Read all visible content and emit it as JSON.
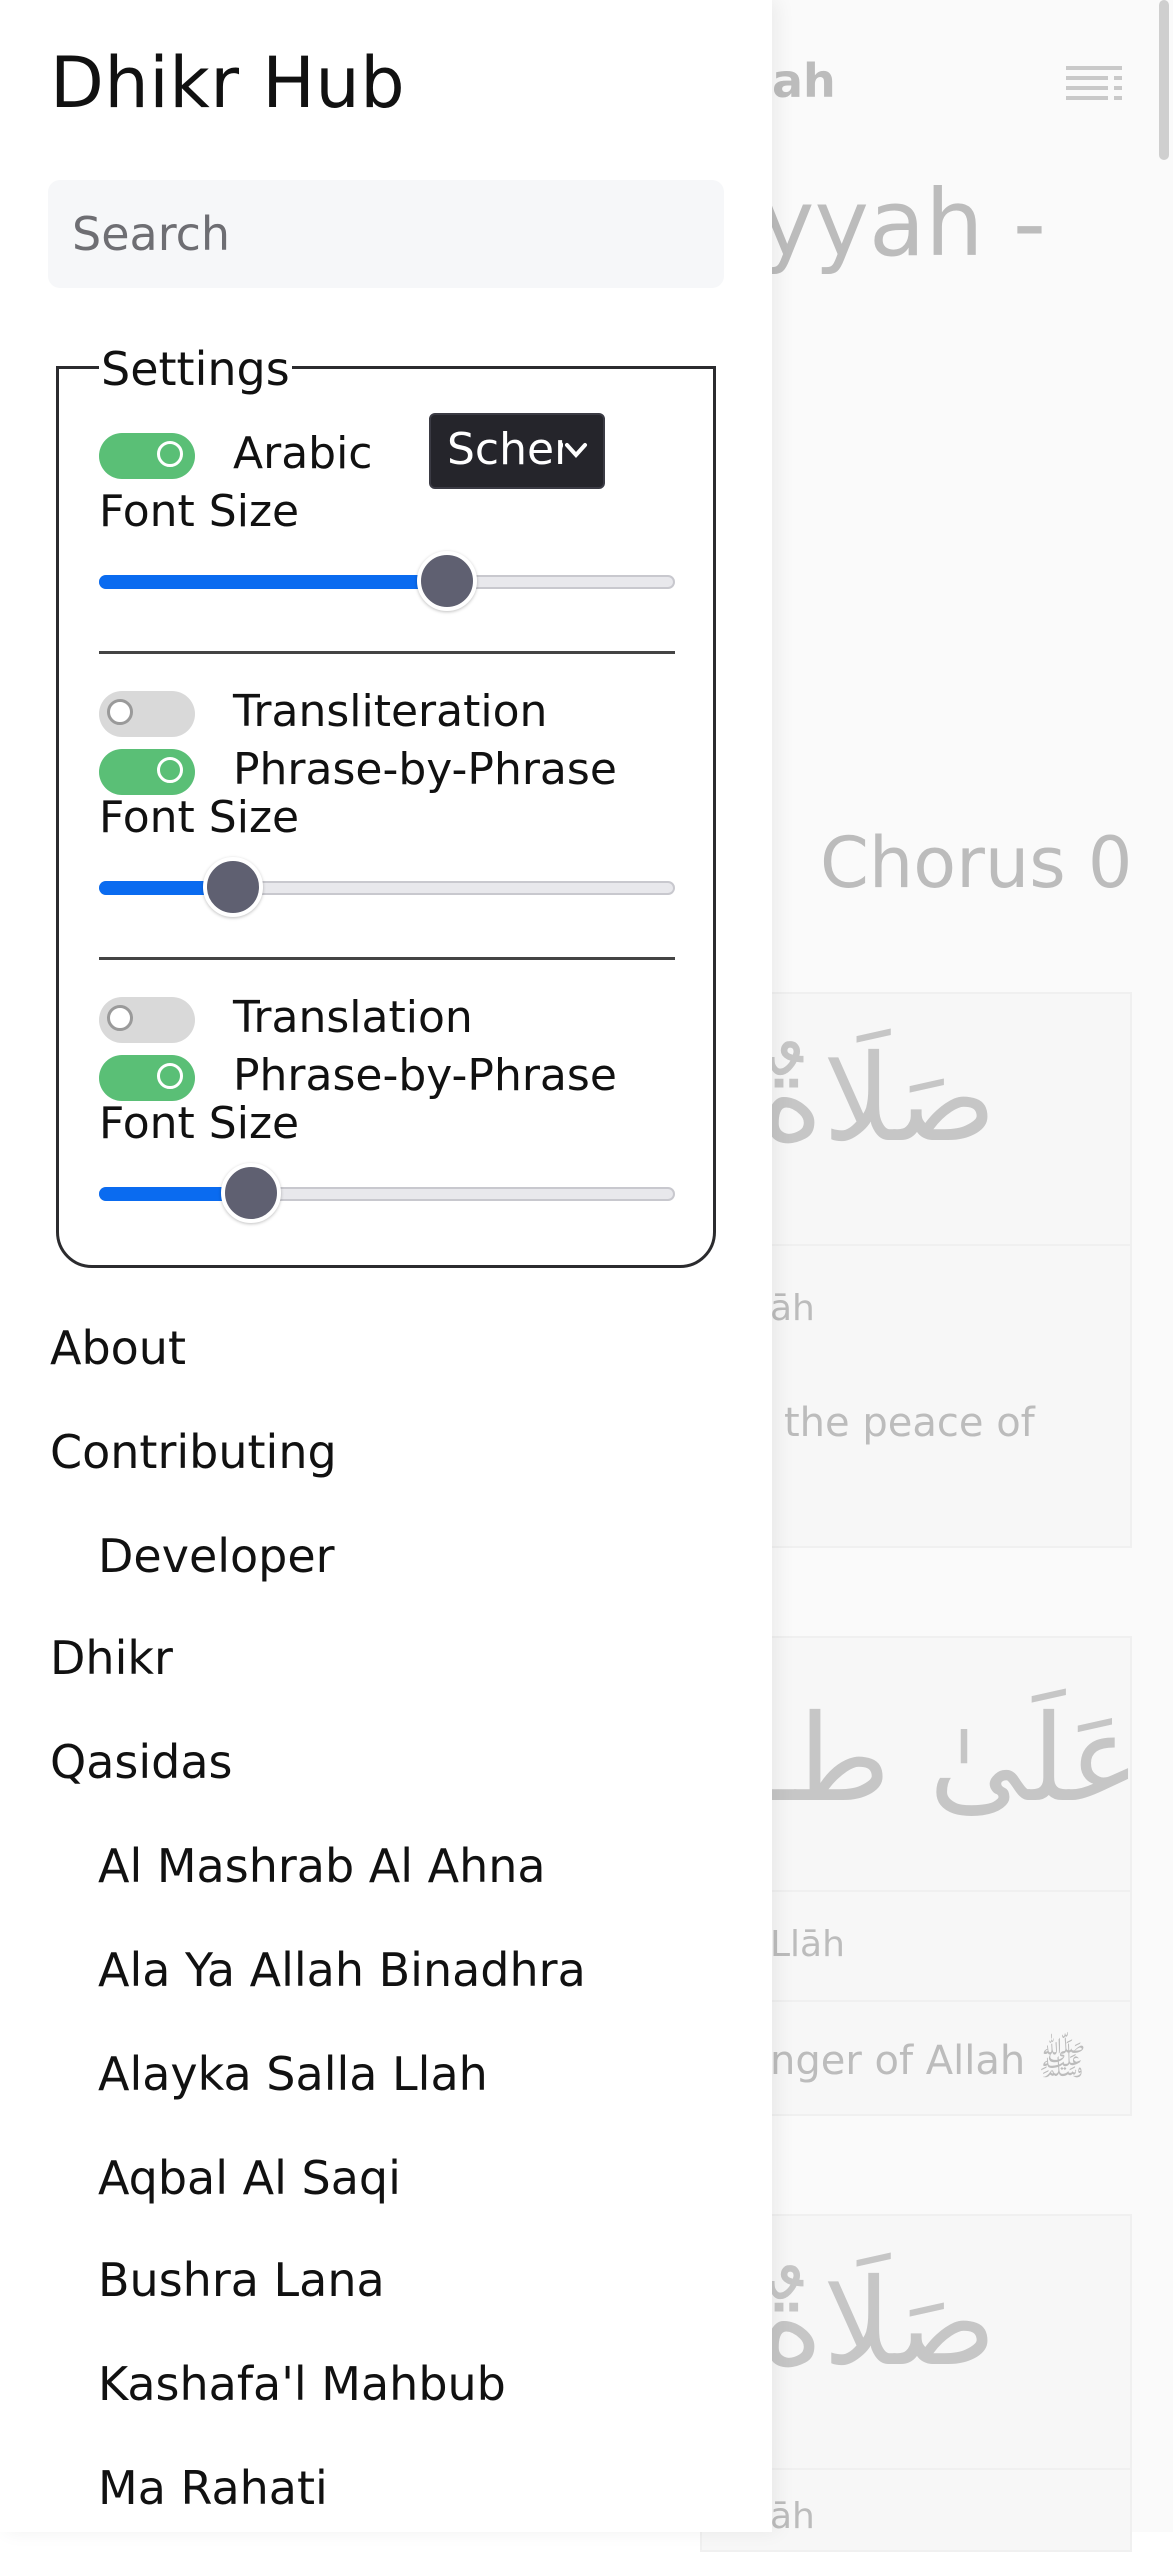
{
  "app": {
    "title": "Dhikr Hub"
  },
  "search": {
    "placeholder": "Search"
  },
  "settings": {
    "legend": "Settings",
    "arabic": {
      "label": "Arabic",
      "enabled": true,
      "scheme_value": "Scheme",
      "font_size_label": "Font Size",
      "font_size_fraction": 0.6
    },
    "transliteration": {
      "label": "Transliteration",
      "enabled": false,
      "phrase_label": "Phrase-by-Phrase",
      "phrase_enabled": true,
      "font_size_label": "Font Size",
      "font_size_fraction": 0.23
    },
    "translation": {
      "label": "Translation",
      "enabled": false,
      "phrase_label": "Phrase-by-Phrase",
      "phrase_enabled": true,
      "font_size_label": "Font Size",
      "font_size_fraction": 0.26
    }
  },
  "nav": {
    "about": "About",
    "contributing": "Contributing",
    "developer": "Developer",
    "dhikr": "Dhikr",
    "qasidas": "Qasidas",
    "qasida_items": [
      "Al Mashrab Al Ahna",
      "Ala Ya Allah Binadhra",
      "Alayka Salla Llah",
      "Aqbal Al Saqi",
      "Bushra Lana",
      "Kashafa'l Mahbub",
      "Ma Rahati"
    ]
  },
  "background": {
    "header_fragment": "ah",
    "title_fragment": "yyah -",
    "section_label": "Chorus 0",
    "arabic_line_1": "صَلَاةٌ",
    "translit_1": "āh",
    "translation_1": "the peace of",
    "arabic_line_2": "عَلَىٰ طـ",
    "translit_2": "Llāh",
    "translation_2": "nger of Allah ﷺ",
    "arabic_line_3": "صَلَاةٌ",
    "translit_3": "āh"
  },
  "colors": {
    "toggle_on": "#5abf76",
    "slider_fill": "#0a6bf0",
    "thumb": "#5f6071"
  }
}
